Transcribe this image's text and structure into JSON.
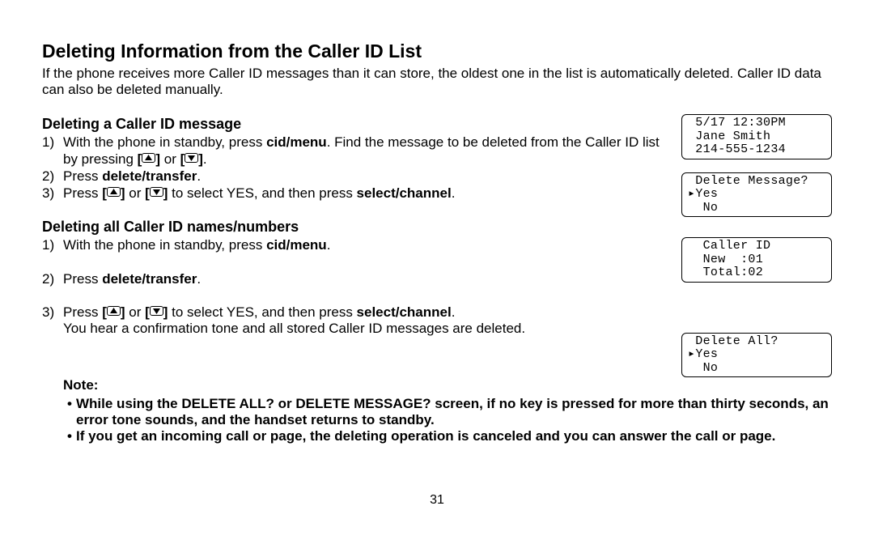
{
  "title": "Deleting Information from the Caller ID List",
  "intro": "If the phone receives more Caller ID messages than it can store, the oldest one in the list is automatically deleted. Caller ID data can also be deleted manually.",
  "section1": {
    "heading": "Deleting a Caller ID message",
    "s1a": "With the phone in standby, press ",
    "s1b": "cid/menu",
    "s1c": ". Find the message to be deleted from the Caller ID list by pressing ",
    "s1d": " or ",
    "s1e": ".",
    "s2a": "Press ",
    "s2b": "delete/transfer",
    "s2c": ".",
    "s3a": "Press ",
    "s3b": " or ",
    "s3c": " to select YES, and then press ",
    "s3d": "select/channel",
    "s3e": "."
  },
  "section2": {
    "heading": "Deleting all Caller ID names/numbers",
    "s1a": "With the phone in standby, press ",
    "s1b": "cid/menu",
    "s1c": ".",
    "s2a": "Press ",
    "s2b": "delete/transfer",
    "s2c": ".",
    "s3a": "Press ",
    "s3b": " or ",
    "s3c": " to select YES, and then press ",
    "s3d": "select/channel",
    "s3e": ".",
    "s3f": "You hear a confirmation tone and all stored Caller ID messages are deleted."
  },
  "note": {
    "label": "Note:",
    "b1": "While using the DELETE ALL? or DELETE MESSAGE? screen, if no key is pressed for more than thirty seconds, an error tone sounds, and the handset returns to standby.",
    "b2": "If you get an incoming call or page, the deleting operation is canceled and you can answer the call or page."
  },
  "lcd1": {
    "l1": " 5/17 12:30PM",
    "l2": " Jane Smith",
    "l3": " 214-555-1234"
  },
  "lcd2": {
    "l1": " Delete Message?",
    "l2": "▸Yes",
    "l3": "  No"
  },
  "lcd3": {
    "l1": "  Caller ID",
    "l2": "  New  :01",
    "l3": "  Total:02"
  },
  "lcd4": {
    "l1": " Delete All?",
    "l2": "▸Yes",
    "l3": "  No"
  },
  "page": "31"
}
